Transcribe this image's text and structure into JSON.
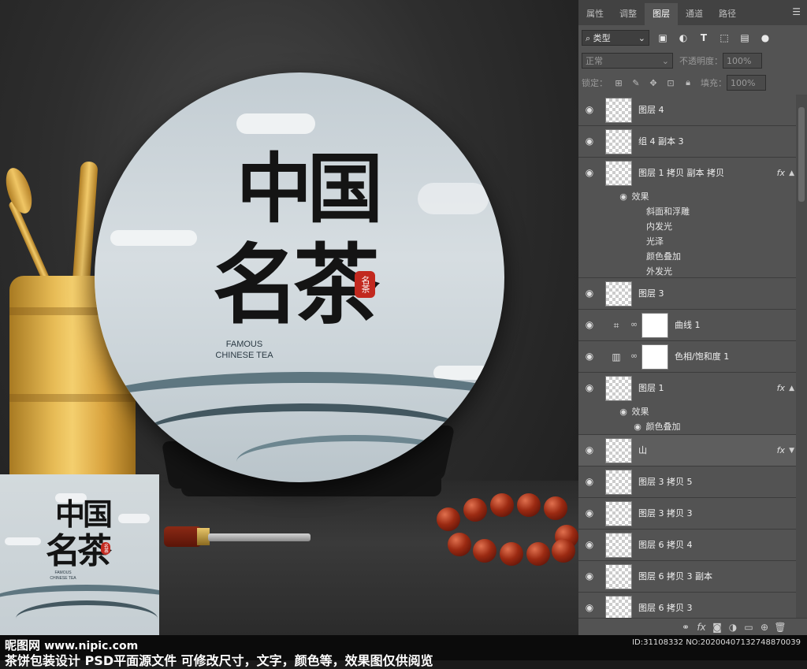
{
  "watermark": {
    "site_name": "昵图网",
    "site_url": "www.nipic.com",
    "caption": "茶饼包装设计 PSD平面源文件 可修改尺寸，文字，颜色等，效果图仅供阅览",
    "id_line": "ID:31108332 NO:20200407132748870039"
  },
  "artwork": {
    "title_line1": "中国",
    "title_line2": "名茶",
    "seal_text": "名茶",
    "english_line1": "FAMOUS",
    "english_line2": "CHINESE TEA"
  },
  "panel": {
    "tabs": [
      "属性",
      "调整",
      "图层",
      "通道",
      "路径"
    ],
    "active_tab": "图层",
    "menu_icon": "panel-menu-icon",
    "filter_kind": "类型",
    "filter_icons": [
      "image-filter-icon",
      "adjustment-filter-icon",
      "type-filter-icon",
      "shape-filter-icon",
      "smart-object-filter-icon",
      "toggle-filter-icon"
    ],
    "blend_mode": "正常",
    "opacity_label": "不透明度：",
    "opacity_value": "100%",
    "lock_label": "锁定：",
    "fill_label": "填充：",
    "fill_value": "100%",
    "lock_icons": [
      "lock-pixels-icon",
      "lock-image-icon",
      "lock-position-icon",
      "lock-artboard-icon",
      "lock-all-icon"
    ],
    "effects_label": "效果",
    "layers": {
      "l1": "图层 4",
      "l2": "组 4 副本 3",
      "l3": "图层 1 拷贝 副本 拷贝",
      "l3_effects": [
        "斜面和浮雕",
        "内发光",
        "光泽",
        "颜色叠加",
        "外发光"
      ],
      "l4": "图层 3",
      "l5": "曲线 1",
      "l6": "色相/饱和度 1",
      "l7": "图层 1",
      "l7_effects": [
        "颜色叠加"
      ],
      "l8": "山",
      "l9": "图层 3 拷贝 5",
      "l10": "图层 3 拷贝 3",
      "l11": "图层 6 拷贝 4",
      "l12": "图层 6 拷贝 3 副本",
      "l13": "图层 6 拷贝 3"
    },
    "fx_label": "fx",
    "bottom_icons": [
      "link-layers-icon",
      "fx-icon",
      "add-mask-icon",
      "new-adjustment-icon",
      "new-group-icon",
      "new-layer-icon",
      "delete-layer-icon"
    ]
  },
  "colors": {
    "panel_bg": "#535353",
    "seal_red": "#c2291f"
  }
}
